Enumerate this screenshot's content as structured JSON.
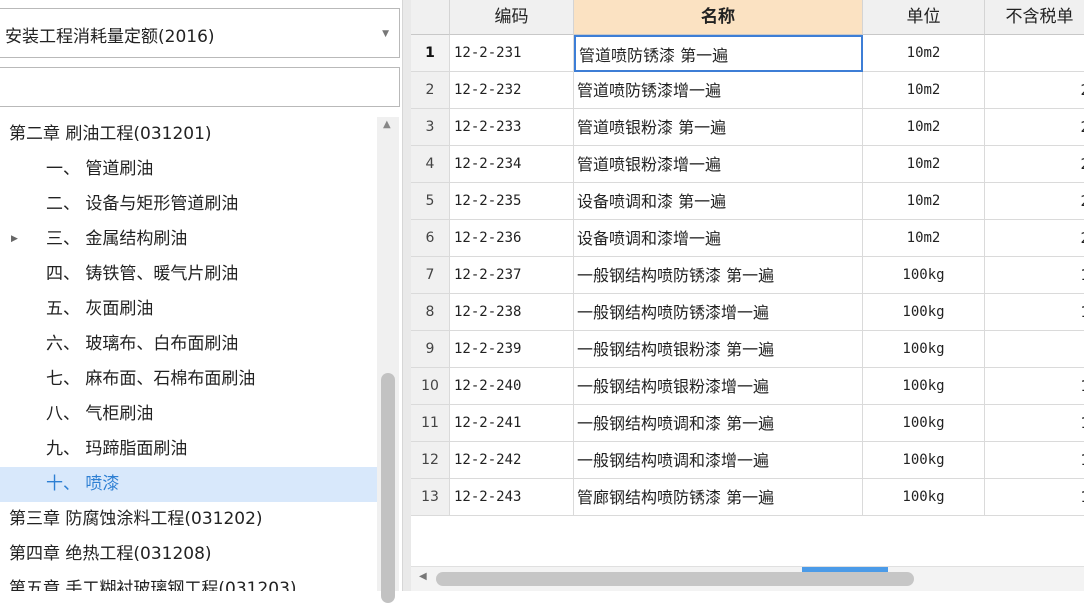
{
  "left": {
    "quota_dropdown": {
      "selected": "安装工程消耗量定额(2016)"
    },
    "search": {
      "value": ""
    },
    "tree": [
      {
        "label": "第二章 刷油工程(031201)",
        "level": 0,
        "expandable": false,
        "selected": false
      },
      {
        "label": "一、 管道刷油",
        "level": 1,
        "expandable": false,
        "selected": false
      },
      {
        "label": "二、 设备与矩形管道刷油",
        "level": 1,
        "expandable": false,
        "selected": false
      },
      {
        "label": "三、 金属结构刷油",
        "level": 1,
        "expandable": true,
        "selected": false
      },
      {
        "label": "四、 铸铁管、暖气片刷油",
        "level": 1,
        "expandable": false,
        "selected": false
      },
      {
        "label": "五、 灰面刷油",
        "level": 1,
        "expandable": false,
        "selected": false
      },
      {
        "label": "六、 玻璃布、白布面刷油",
        "level": 1,
        "expandable": false,
        "selected": false
      },
      {
        "label": "七、 麻布面、石棉布面刷油",
        "level": 1,
        "expandable": false,
        "selected": false
      },
      {
        "label": "八、 气柜刷油",
        "level": 1,
        "expandable": false,
        "selected": false
      },
      {
        "label": "九、 玛蹄脂面刷油",
        "level": 1,
        "expandable": false,
        "selected": false
      },
      {
        "label": "十、 喷漆",
        "level": 1,
        "expandable": false,
        "selected": true
      },
      {
        "label": "第三章 防腐蚀涂料工程(031202)",
        "level": 0,
        "expandable": false,
        "selected": false
      },
      {
        "label": "第四章 绝热工程(031208)",
        "level": 0,
        "expandable": false,
        "selected": false
      },
      {
        "label": "第五章 手工糊衬玻璃钢工程(031203)",
        "level": 0,
        "expandable": false,
        "selected": false
      }
    ]
  },
  "grid": {
    "columns": [
      "",
      "编码",
      "名称",
      "单位",
      "不含税单"
    ],
    "active_column": 2,
    "current_row": 0,
    "rows": [
      {
        "idx": "1",
        "code": "12-2-231",
        "name": "管道喷防锈漆 第一遍",
        "unit": "10m2",
        "price": ""
      },
      {
        "idx": "2",
        "code": "12-2-232",
        "name": "管道喷防锈漆增一遍",
        "unit": "10m2",
        "price": "2"
      },
      {
        "idx": "3",
        "code": "12-2-233",
        "name": "管道喷银粉漆 第一遍",
        "unit": "10m2",
        "price": "2"
      },
      {
        "idx": "4",
        "code": "12-2-234",
        "name": "管道喷银粉漆增一遍",
        "unit": "10m2",
        "price": "2"
      },
      {
        "idx": "5",
        "code": "12-2-235",
        "name": "设备喷调和漆 第一遍",
        "unit": "10m2",
        "price": "2"
      },
      {
        "idx": "6",
        "code": "12-2-236",
        "name": "设备喷调和漆增一遍",
        "unit": "10m2",
        "price": "2"
      },
      {
        "idx": "7",
        "code": "12-2-237",
        "name": "一般钢结构喷防锈漆 第一遍",
        "unit": "100kg",
        "price": "1"
      },
      {
        "idx": "8",
        "code": "12-2-238",
        "name": "一般钢结构喷防锈漆增一遍",
        "unit": "100kg",
        "price": "1"
      },
      {
        "idx": "9",
        "code": "12-2-239",
        "name": "一般钢结构喷银粉漆 第一遍",
        "unit": "100kg",
        "price": ""
      },
      {
        "idx": "10",
        "code": "12-2-240",
        "name": "一般钢结构喷银粉漆增一遍",
        "unit": "100kg",
        "price": "1"
      },
      {
        "idx": "11",
        "code": "12-2-241",
        "name": "一般钢结构喷调和漆 第一遍",
        "unit": "100kg",
        "price": "1"
      },
      {
        "idx": "12",
        "code": "12-2-242",
        "name": "一般钢结构喷调和漆增一遍",
        "unit": "100kg",
        "price": "1"
      },
      {
        "idx": "13",
        "code": "12-2-243",
        "name": "管廊钢结构喷防锈漆 第一遍",
        "unit": "100kg",
        "price": "1"
      }
    ]
  },
  "icons": {
    "dropdown_arrow": "chevron-down-icon",
    "tree_expander": "triangle-right-icon",
    "scroll_up": "arrow-up-icon",
    "scroll_left": "arrow-left-icon"
  }
}
